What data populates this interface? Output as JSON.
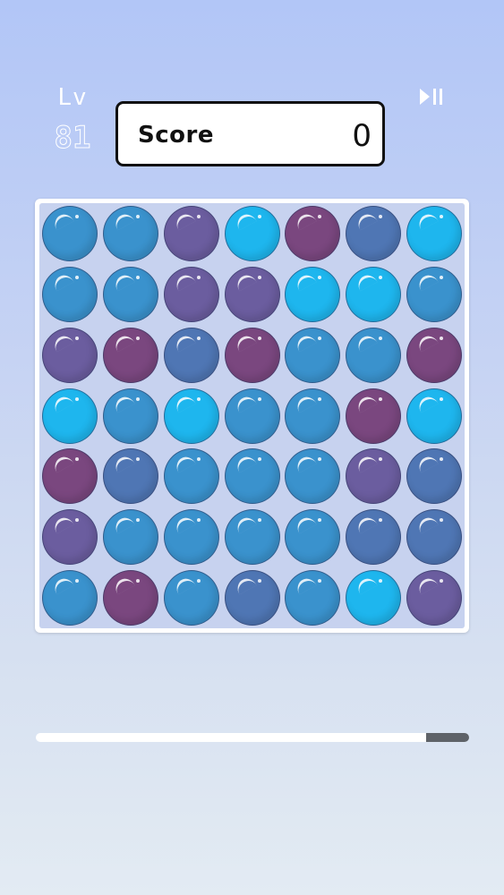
{
  "hud": {
    "level_label": "Lv",
    "level_value": "81",
    "score_label": "Score",
    "score_value": "0",
    "play_pause_icon": "play-pause-icon"
  },
  "colors": {
    "A": "#3a92cd",
    "B": "#6b5d9f",
    "C": "#1eb6ee",
    "D": "#7a477f",
    "E": "#4f76b4"
  },
  "board": {
    "rows": 7,
    "cols": 7,
    "grid": [
      [
        "A",
        "A",
        "B",
        "C",
        "D",
        "E",
        "C"
      ],
      [
        "A",
        "A",
        "B",
        "B",
        "C",
        "C",
        "A"
      ],
      [
        "B",
        "D",
        "E",
        "D",
        "A",
        "A",
        "D"
      ],
      [
        "C",
        "A",
        "C",
        "A",
        "A",
        "D",
        "C"
      ],
      [
        "D",
        "E",
        "A",
        "A",
        "A",
        "B",
        "E"
      ],
      [
        "B",
        "A",
        "A",
        "A",
        "A",
        "E",
        "E"
      ],
      [
        "A",
        "D",
        "A",
        "E",
        "A",
        "C",
        "B"
      ]
    ]
  },
  "timer": {
    "remaining_fraction": 0.1
  }
}
